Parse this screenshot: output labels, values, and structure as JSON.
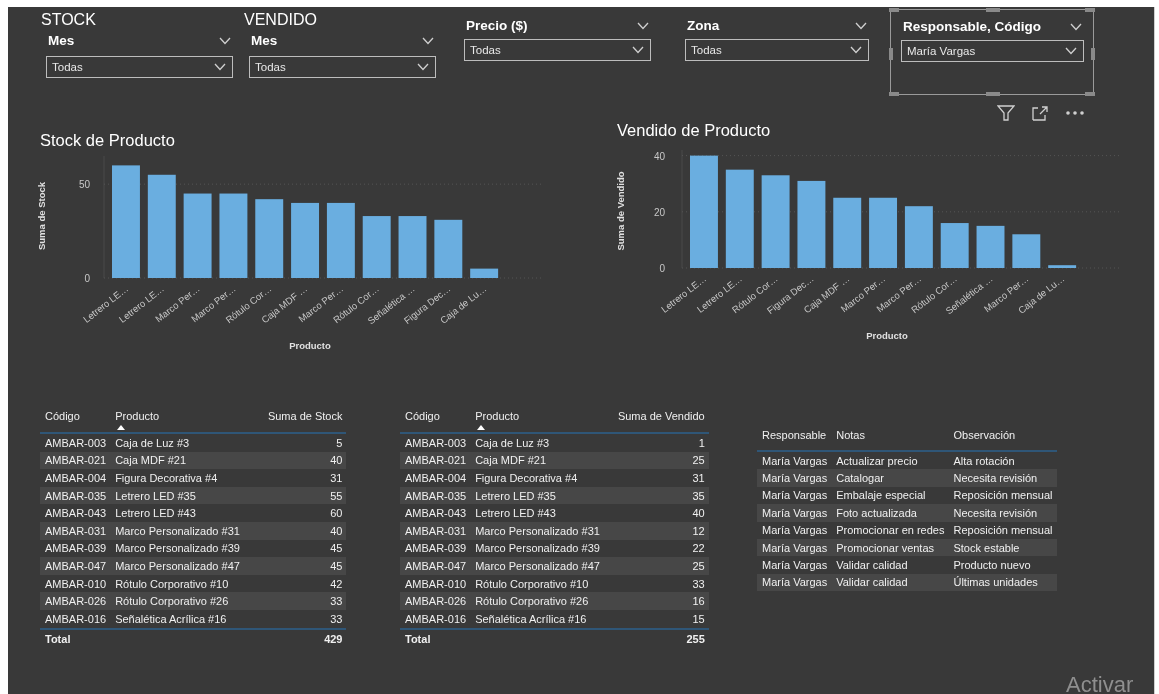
{
  "slicers": [
    {
      "group_title": "STOCK",
      "label": "Mes",
      "value": "Todas",
      "selected": false
    },
    {
      "group_title": "VENDIDO",
      "label": "Mes",
      "value": "Todas",
      "selected": false
    },
    {
      "label": "Precio ($)",
      "value": "Todas",
      "selected": false
    },
    {
      "label": "Zona",
      "value": "Todas",
      "selected": false
    },
    {
      "label": "Responsable, Código",
      "value": "María Vargas",
      "selected": true
    }
  ],
  "charts": [
    {
      "title": "Stock de Producto",
      "chart_data": {
        "type": "bar",
        "xlabel": "Producto",
        "ylabel": "Suma de Stock",
        "categories": [
          "Letrero LE…",
          "Letrero LE…",
          "Marco Per…",
          "Marco Per…",
          "Rótulo Cor…",
          "Caja MDF …",
          "Marco Per…",
          "Rótulo Cor…",
          "Señalética …",
          "Figura Dec…",
          "Caja de Lu…"
        ],
        "values": [
          60,
          55,
          45,
          45,
          42,
          40,
          40,
          33,
          33,
          31,
          5
        ],
        "ylim": [
          0,
          65
        ],
        "yticks": [
          0,
          50
        ]
      }
    },
    {
      "title": "Vendido de Producto",
      "chart_data": {
        "type": "bar",
        "xlabel": "Producto",
        "ylabel": "Suma de Vendido",
        "categories": [
          "Letrero LE…",
          "Letrero LE…",
          "Rótulo Cor…",
          "Figura Dec…",
          "Caja MDF …",
          "Marco Per…",
          "Marco Per…",
          "Rótulo Cor…",
          "Señalética …",
          "Marco Per…",
          "Caja de Lu…"
        ],
        "values": [
          40,
          35,
          33,
          31,
          25,
          25,
          22,
          16,
          15,
          12,
          1
        ],
        "ylim": [
          0,
          42
        ],
        "yticks": [
          0,
          20,
          40
        ]
      }
    }
  ],
  "tables": [
    {
      "columns": [
        {
          "label": "Código",
          "sorted": false
        },
        {
          "label": "Producto",
          "sorted": true
        },
        {
          "label": "Suma de Stock",
          "sorted": false,
          "numeric": true
        }
      ],
      "rows": [
        [
          "AMBAR-003",
          "Caja de Luz #3",
          "5"
        ],
        [
          "AMBAR-021",
          "Caja MDF #21",
          "40"
        ],
        [
          "AMBAR-004",
          "Figura Decorativa #4",
          "31"
        ],
        [
          "AMBAR-035",
          "Letrero LED #35",
          "55"
        ],
        [
          "AMBAR-043",
          "Letrero LED #43",
          "60"
        ],
        [
          "AMBAR-031",
          "Marco Personalizado #31",
          "40"
        ],
        [
          "AMBAR-039",
          "Marco Personalizado #39",
          "45"
        ],
        [
          "AMBAR-047",
          "Marco Personalizado #47",
          "45"
        ],
        [
          "AMBAR-010",
          "Rótulo Corporativo #10",
          "42"
        ],
        [
          "AMBAR-026",
          "Rótulo Corporativo #26",
          "33"
        ],
        [
          "AMBAR-016",
          "Señalética Acrílica #16",
          "33"
        ]
      ],
      "total": {
        "label": "Total",
        "value": "429"
      }
    },
    {
      "columns": [
        {
          "label": "Código",
          "sorted": false
        },
        {
          "label": "Producto",
          "sorted": true
        },
        {
          "label": "Suma de Vendido",
          "sorted": false,
          "numeric": true
        }
      ],
      "rows": [
        [
          "AMBAR-003",
          "Caja de Luz #3",
          "1"
        ],
        [
          "AMBAR-021",
          "Caja MDF #21",
          "25"
        ],
        [
          "AMBAR-004",
          "Figura Decorativa #4",
          "31"
        ],
        [
          "AMBAR-035",
          "Letrero LED #35",
          "35"
        ],
        [
          "AMBAR-043",
          "Letrero LED #43",
          "40"
        ],
        [
          "AMBAR-031",
          "Marco Personalizado #31",
          "12"
        ],
        [
          "AMBAR-039",
          "Marco Personalizado #39",
          "22"
        ],
        [
          "AMBAR-047",
          "Marco Personalizado #47",
          "25"
        ],
        [
          "AMBAR-010",
          "Rótulo Corporativo #10",
          "33"
        ],
        [
          "AMBAR-026",
          "Rótulo Corporativo #26",
          "16"
        ],
        [
          "AMBAR-016",
          "Señalética Acrílica #16",
          "15"
        ]
      ],
      "total": {
        "label": "Total",
        "value": "255"
      }
    },
    {
      "columns": [
        {
          "label": "Responsable",
          "sorted": false
        },
        {
          "label": "Notas",
          "sorted": false
        },
        {
          "label": "Observación",
          "sorted": false
        }
      ],
      "rows": [
        [
          "María Vargas",
          "Actualizar precio",
          "Alta rotación"
        ],
        [
          "María Vargas",
          "Catalogar",
          "Necesita revisión"
        ],
        [
          "María Vargas",
          "Embalaje especial",
          "Reposición mensual"
        ],
        [
          "María Vargas",
          "Foto actualizada",
          "Necesita revisión"
        ],
        [
          "María Vargas",
          "Promocionar en redes",
          "Reposición mensual"
        ],
        [
          "María Vargas",
          "Promocionar ventas",
          "Stock estable"
        ],
        [
          "María Vargas",
          "Validar calidad",
          "Producto nuevo"
        ],
        [
          "María Vargas",
          "Validar calidad",
          "Últimas unidades"
        ]
      ]
    }
  ],
  "activation_notice": "Activar"
}
